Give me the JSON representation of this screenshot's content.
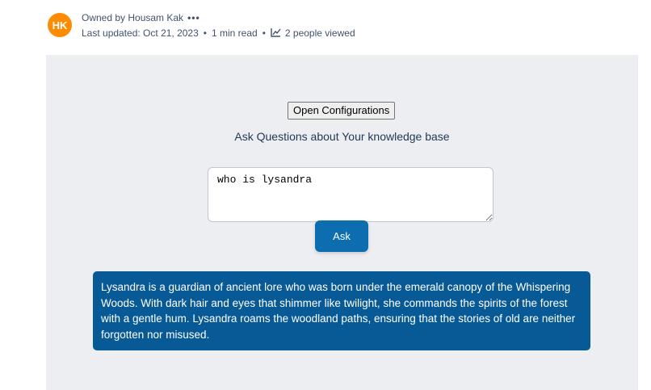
{
  "owner": {
    "initials": "HK",
    "owned_by": "Owned by Housam Kak",
    "more": "•••",
    "avatar_color": "#ff8b00"
  },
  "meta": {
    "last_updated": "Last updated: Oct 21, 2023",
    "separator": "•",
    "read_time": "1 min read",
    "views": "2 people viewed",
    "views_icon": "line-chart-icon"
  },
  "panel": {
    "config_button": "Open Configurations",
    "subtitle": "Ask Questions about Your knowledge base",
    "question_value": "who is lysandra",
    "ask_button": "Ask",
    "answer": "Lysandra is a guardian of ancient lore who was born under the emerald canopy of the Whispering Woods. With dark hair and eyes that shimmer like twilight, she commands the spirits of the forest with a gentle hum. Lysandra roams the woodland paths, ensuring that the stories of old are neither forgotten nor misused.",
    "panel_color": "#eceef2",
    "ask_button_color": "#0d6eaf",
    "answer_bg_color": "#075a95"
  }
}
